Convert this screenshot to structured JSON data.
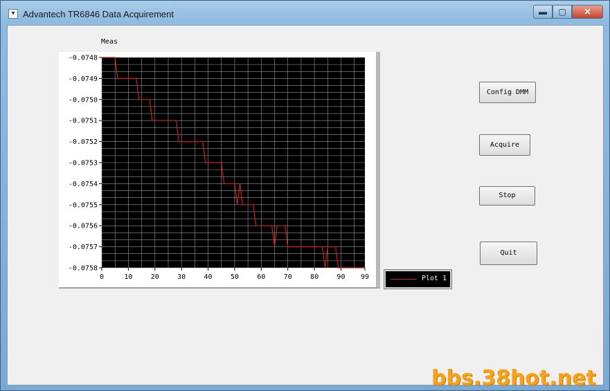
{
  "window": {
    "title": "Advantech TR6846 Data Acquirement",
    "min_glyph": "▬",
    "max_glyph": "▢",
    "close_glyph": "✕"
  },
  "buttons": {
    "config": "Config DMM",
    "acquire": "Acquire",
    "stop": "Stop",
    "quit": "Quit"
  },
  "watermark": "bbs.38hot.net",
  "chart_data": {
    "type": "line",
    "ylabel": "Meas",
    "xlim": [
      0,
      99
    ],
    "ylim": [
      -0.0758,
      -0.0748
    ],
    "xticks": [
      "0",
      "10",
      "20",
      "30",
      "40",
      "50",
      "60",
      "70",
      "80",
      "90",
      "99"
    ],
    "yticks": [
      "-0.0748",
      "-0.0749",
      "-0.0750",
      "-0.0751",
      "-0.0752",
      "-0.0753",
      "-0.0754",
      "-0.0755",
      "-0.0756",
      "-0.0757",
      "-0.0758"
    ],
    "grid": true,
    "background": "#000000",
    "series": [
      {
        "name": "Plot 1",
        "color": "#cc2020",
        "x": [
          0,
          5,
          6,
          13,
          14,
          18,
          19,
          28,
          29,
          38,
          39,
          45,
          46,
          50,
          51,
          52,
          53,
          57,
          58,
          64,
          65,
          66,
          67,
          69,
          70,
          83,
          84,
          85,
          86,
          88,
          89,
          99
        ],
        "y": [
          -0.0748,
          -0.0748,
          -0.0749,
          -0.0749,
          -0.075,
          -0.075,
          -0.0751,
          -0.0751,
          -0.0752,
          -0.0752,
          -0.0753,
          -0.0753,
          -0.0754,
          -0.0754,
          -0.0755,
          -0.0754,
          -0.0755,
          -0.0755,
          -0.0756,
          -0.0756,
          -0.0757,
          -0.0756,
          -0.0756,
          -0.0756,
          -0.0757,
          -0.0757,
          -0.0758,
          -0.0757,
          -0.0757,
          -0.0757,
          -0.0758,
          -0.0758
        ]
      }
    ]
  }
}
